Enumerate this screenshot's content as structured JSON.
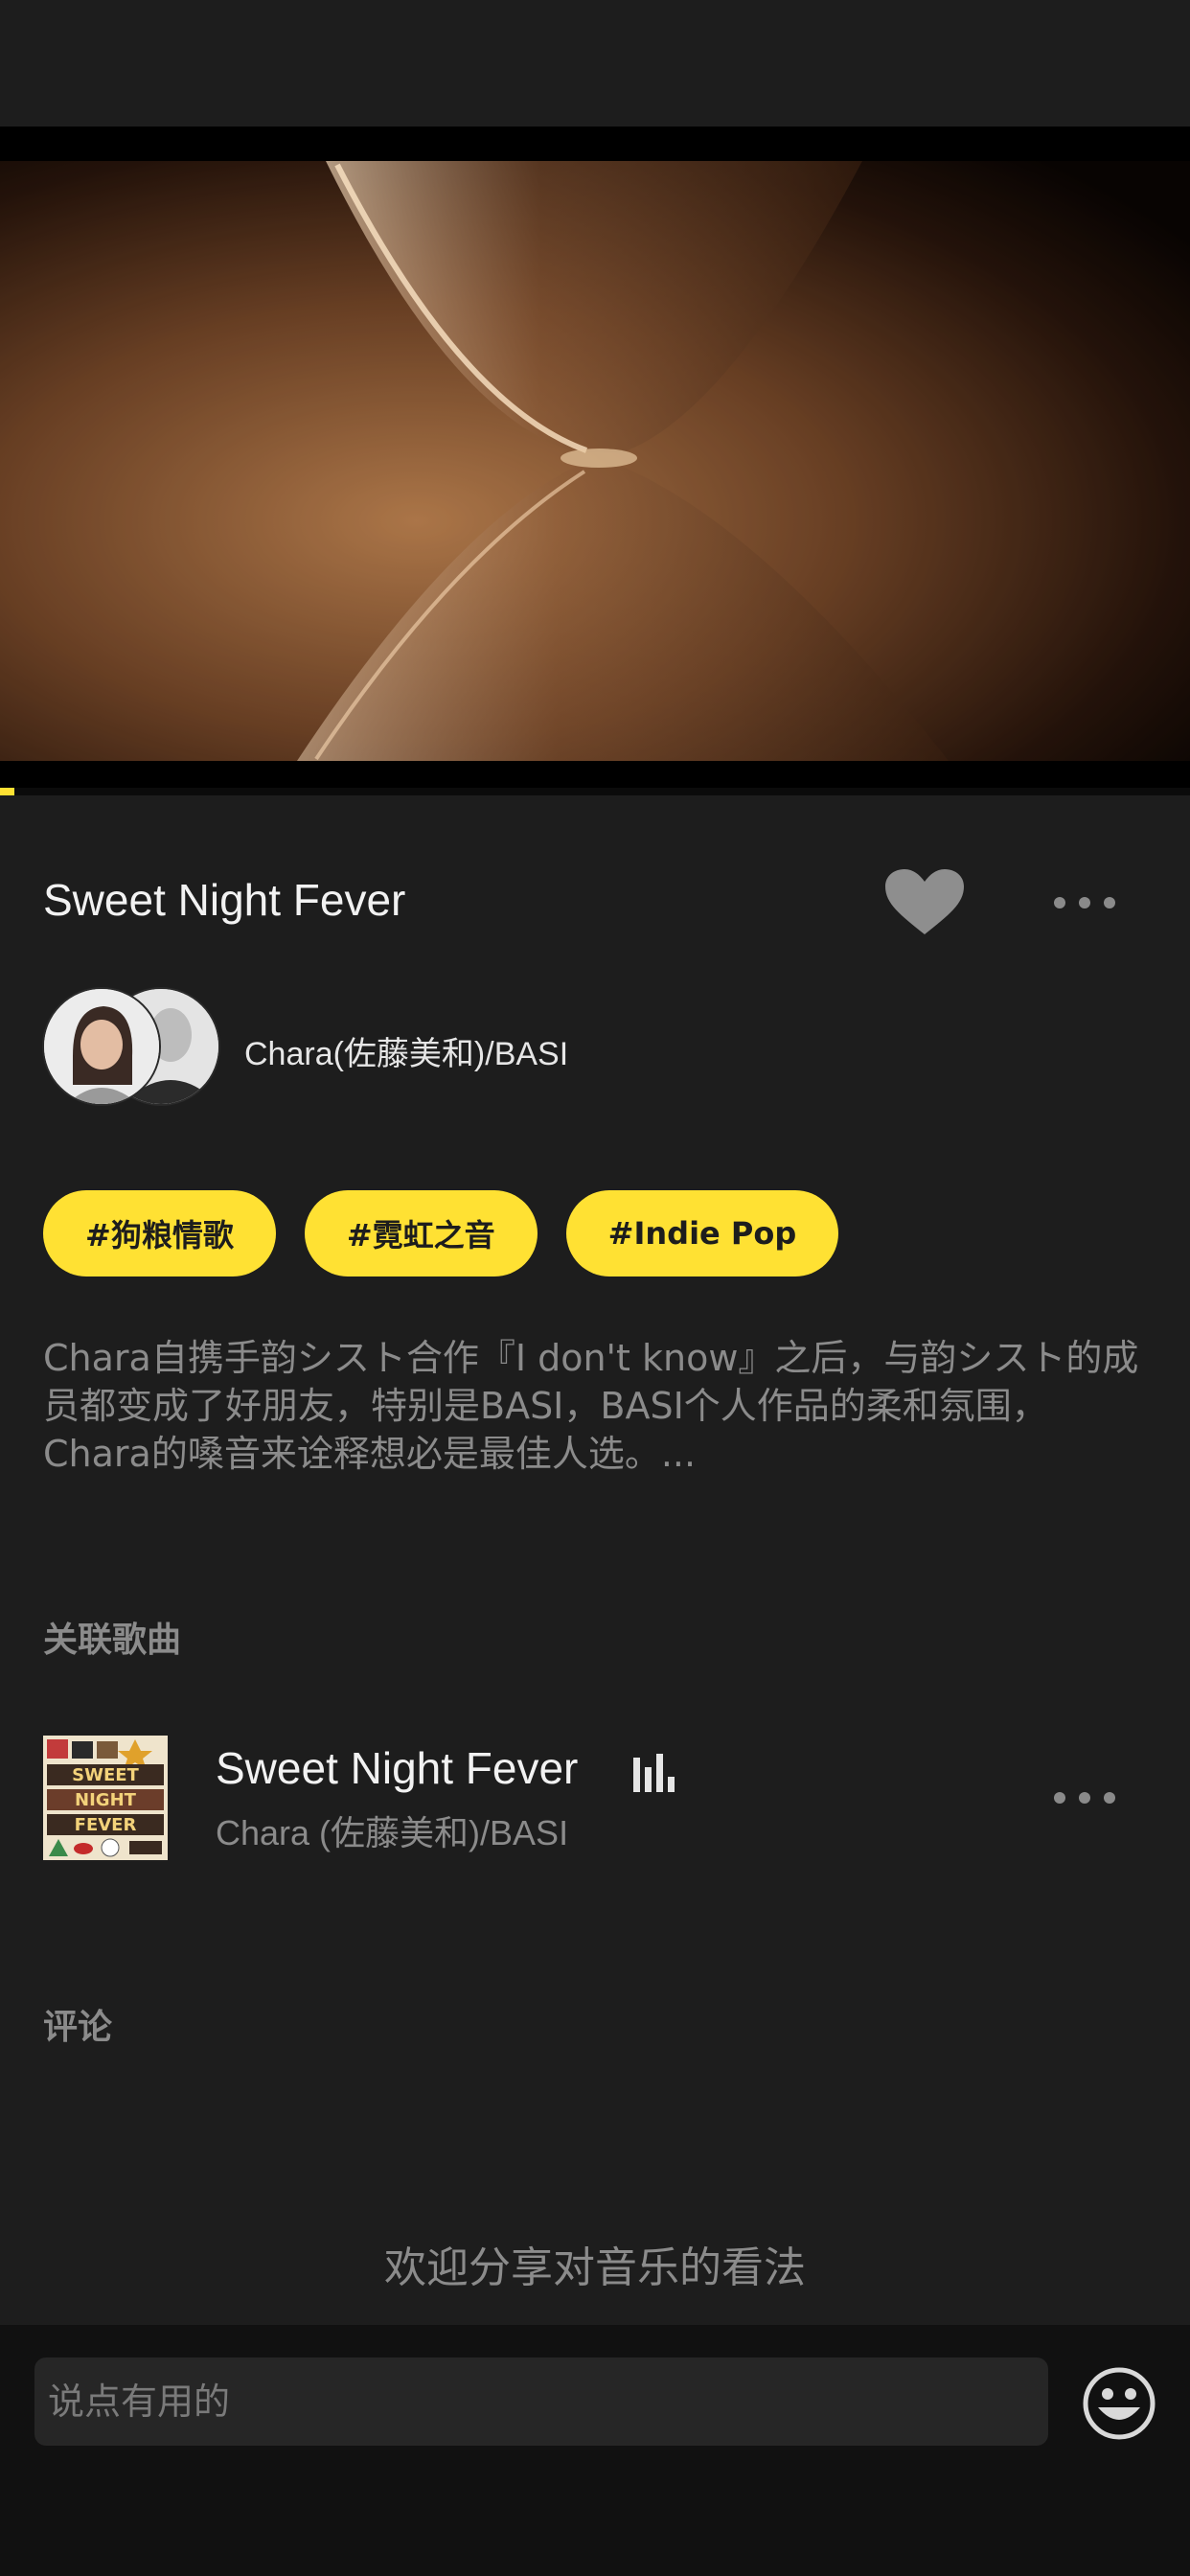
{
  "player": {
    "progress": 0.012,
    "accent_color": "#ffe133"
  },
  "song": {
    "title": "Sweet Night Fever",
    "artist": "Chara(佐藤美和)/BASI"
  },
  "icons": {
    "like": "heart-icon",
    "more": "more-dots-icon",
    "playing": "equalizer-icon",
    "emoji": "emoji-icon"
  },
  "tags": [
    {
      "label": "#狗粮情歌"
    },
    {
      "label": "#霓虹之音"
    },
    {
      "label": "#Indie Pop"
    }
  ],
  "description": "Chara自携手韵シスト合作『I  don't  know』之后，与韵シスト的成员都变成了好朋友，特别是BASI，BASI个人作品的柔和氛围，Chara的嗓音来诠释想必是最佳人选。...",
  "related": {
    "section_title": "关联歌曲",
    "tracks": [
      {
        "title": "Sweet Night Fever",
        "artist": "Chara (佐藤美和)/BASI"
      }
    ]
  },
  "comments": {
    "section_title": "评论",
    "empty_text": "欢迎分享对音乐的看法",
    "input_placeholder": "说点有用的"
  }
}
